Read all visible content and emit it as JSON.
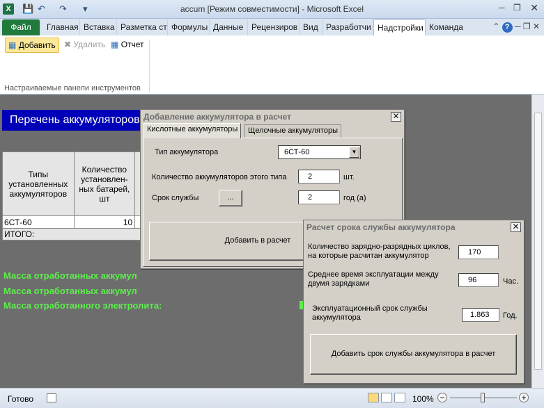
{
  "window": {
    "title": "accum [Режим совместимости] - Microsoft Excel",
    "app_icon": "X"
  },
  "ribbon": {
    "tabs": [
      "Файл",
      "Главная",
      "Вставка",
      "Разметка ст",
      "Формулы",
      "Данные",
      "Рецензиров",
      "Вид",
      "Разработчи",
      "Надстройки",
      "Команда"
    ],
    "active_tab": "Надстройки",
    "buttons": {
      "add": "Добавить",
      "delete": "Удалить",
      "report": "Отчет"
    },
    "group_label": "Настраиваемые панели инструментов"
  },
  "sheet": {
    "title": "Перечень аккумуляторов",
    "table": {
      "col1_header": "Типы установленных аккумуляторов",
      "col2_header": "Количество установлен-ных батарей, шт",
      "rows": [
        {
          "type": "6СТ-60",
          "count": "10"
        }
      ],
      "total_label": "ИТОГО:"
    },
    "mass_labels": [
      "Масса отработанных аккумул",
      "Масса отработанных аккумул",
      "Масса отработанного электролита:"
    ]
  },
  "dialog_add": {
    "title": "Добавление аккумулятора в расчет",
    "tabs": [
      "Кислотные аккумуляторы",
      "Щелочные аккумуляторы"
    ],
    "battery_type_label": "Тип аккумулятора",
    "battery_type_value": "6СТ-60",
    "quantity_label": "Количество аккумуляторов этого типа",
    "quantity_value": "2",
    "quantity_unit": "шт.",
    "lifetime_label": "Срок службы",
    "lifetime_button": "...",
    "lifetime_value": "2",
    "lifetime_unit": "год (а)",
    "add_button": "Добавить в расчет"
  },
  "dialog_lifetime": {
    "title": "Расчет срока службы аккумулятора",
    "cycles_label_1": "Количество зарядно-разрядных циклов,",
    "cycles_label_2": "на которые расчитан аккумулятор",
    "cycles_value": "170",
    "avg_time_label_1": "Среднее время эксплуатации между",
    "avg_time_label_2": "двумя зарядками",
    "avg_time_value": "96",
    "avg_time_unit": "Час.",
    "service_label_1": "Эксплуатационный срок службы",
    "service_label_2": "аккумулятора",
    "service_value": "1.863",
    "service_unit": "Год.",
    "add_button": "Добавить срок службы аккумулятора в расчет"
  },
  "statusbar": {
    "ready": "Готово",
    "zoom": "100%"
  }
}
